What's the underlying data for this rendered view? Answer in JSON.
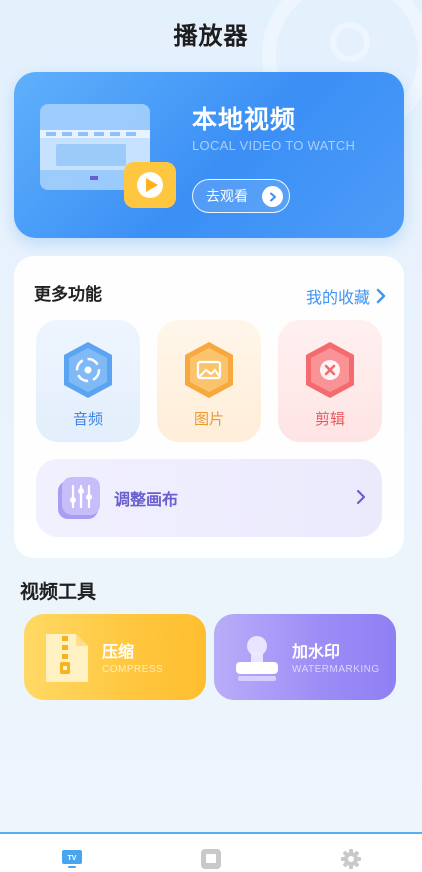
{
  "app": {
    "title": "播放器"
  },
  "hero": {
    "title": "本地视频",
    "subtitle": "LOCAL VIDEO TO WATCH",
    "button_label": "去观看"
  },
  "more": {
    "title": "更多功能",
    "favorites_label": "我的收藏",
    "tiles": [
      {
        "label": "音频",
        "icon": "audio-icon",
        "color": "#3f84e6"
      },
      {
        "label": "图片",
        "icon": "image-icon",
        "color": "#e99934"
      },
      {
        "label": "剪辑",
        "icon": "cut-icon",
        "color": "#e9595e"
      }
    ],
    "canvas_label": "调整画布"
  },
  "tools": {
    "title": "视频工具",
    "items": [
      {
        "label": "压缩",
        "sub": "COMPRESS",
        "icon": "zip-icon"
      },
      {
        "label": "加水印",
        "sub": "WATERMARKING",
        "icon": "stamp-icon"
      }
    ]
  },
  "nav": {
    "items": [
      {
        "name": "tv-icon",
        "active": true
      },
      {
        "name": "gallery-icon",
        "active": false
      },
      {
        "name": "settings-icon",
        "active": false
      }
    ],
    "accent": "#58b0f1"
  }
}
